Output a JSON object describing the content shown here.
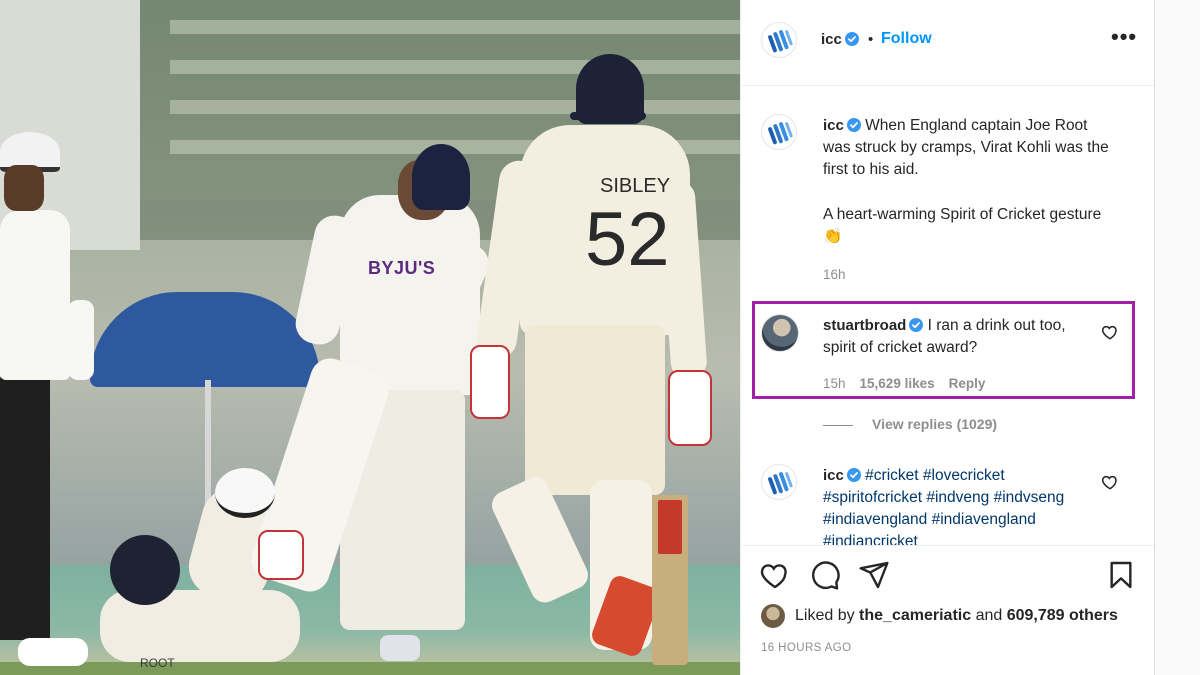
{
  "post": {
    "username": "icc",
    "follow_label": "Follow",
    "more_label": "•••",
    "dot": "•"
  },
  "comments": [
    {
      "username": "icc",
      "text": "When England captain Joe Root was struck by cramps, Virat Kohli was the first to his aid.",
      "text2": "A heart-warming Spirit of Cricket gesture 👏",
      "time": "16h"
    },
    {
      "username": "stuartbroad",
      "text": "I ran a drink out too, spirit of cricket award?",
      "time": "15h",
      "likes": "15,629 likes",
      "reply": "Reply"
    },
    {
      "username": "icc",
      "text": "#cricket #lovecricket #spiritofcricket #indveng #indvseng #indiavengland #indiavengland #indiancricket"
    }
  ],
  "view_replies": "View replies (1029)",
  "liked_by": {
    "prefix": "Liked by",
    "user": "the_cameriatic",
    "mid": "and",
    "others": "609,789 others"
  },
  "timestamp": "16 HOURS AGO",
  "photo": {
    "shirt_text": "BYJU'S",
    "player_name": "SIBLEY",
    "player_number": "52",
    "root_text": "ROOT"
  },
  "colors": {
    "accent": "#0095f6",
    "highlight": "#a020a6",
    "verified": "#3897f0",
    "muted": "#8e8e8e"
  },
  "icons": [
    "icc-logo-icon",
    "verified-icon",
    "more-icon",
    "heart-icon",
    "comment-icon",
    "share-icon",
    "bookmark-icon"
  ]
}
